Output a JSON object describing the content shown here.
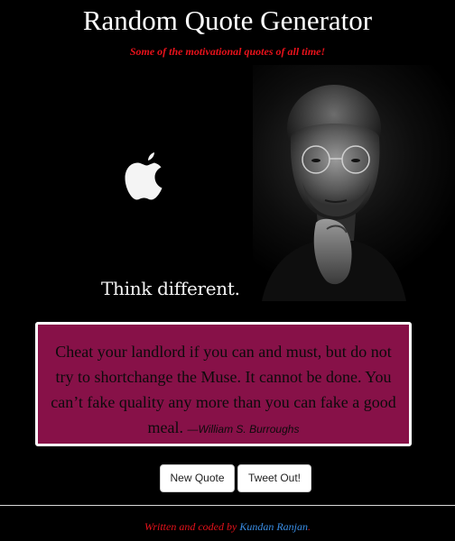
{
  "header": {
    "title": "Random Quote Generator",
    "subtitle": "Some of the motivational quotes of all time!"
  },
  "hero": {
    "tagline": "Think different.",
    "logo_icon": "apple-logo-icon"
  },
  "quote": {
    "text": "Cheat your landlord if you can and must, but do not try to shortchange the Muse. It cannot be done. You can’t fake quality any more than you can fake a good meal.",
    "author": "—William S. Burroughs"
  },
  "buttons": {
    "new_quote": "New Quote",
    "tweet": "Tweet Out!"
  },
  "footer": {
    "prefix": "Written and coded by ",
    "author_link": "Kundan Ranjan",
    "suffix": "."
  },
  "colors": {
    "background": "#000000",
    "quote_box": "#871148",
    "accent_red": "#e8121b",
    "link_blue": "#3a8ee6"
  }
}
